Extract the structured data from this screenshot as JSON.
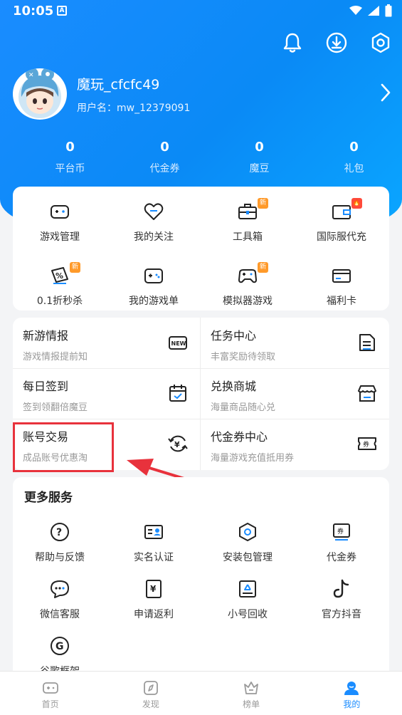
{
  "status_bar": {
    "time": "10:05",
    "badge": "A"
  },
  "header": {
    "icons": [
      "bell-icon",
      "download-icon",
      "settings-icon"
    ],
    "username": "魔玩_cfcfc49",
    "user_id": "用户名：mw_12379091"
  },
  "stats": [
    {
      "value": "0",
      "label": "平台币"
    },
    {
      "value": "0",
      "label": "代金券"
    },
    {
      "value": "0",
      "label": "魔豆"
    },
    {
      "value": "0",
      "label": "礼包"
    }
  ],
  "tools": [
    {
      "label": "游戏管理",
      "icon": "gamepad-icon",
      "tag": ""
    },
    {
      "label": "我的关注",
      "icon": "heart-icon",
      "tag": ""
    },
    {
      "label": "工具箱",
      "icon": "toolbox-icon",
      "tag": "新"
    },
    {
      "label": "国际服代充",
      "icon": "wallet-icon",
      "tag": "🔥"
    },
    {
      "label": "0.1折秒杀",
      "icon": "discount-icon",
      "tag": "新"
    },
    {
      "label": "我的游戏单",
      "icon": "controller-icon",
      "tag": ""
    },
    {
      "label": "模拟器游戏",
      "icon": "emulator-icon",
      "tag": "新"
    },
    {
      "label": "福利卡",
      "icon": "card-icon",
      "tag": ""
    }
  ],
  "services": [
    {
      "title": "新游情报",
      "subtitle": "游戏情报提前知",
      "icon": "new-icon"
    },
    {
      "title": "任务中心",
      "subtitle": "丰富奖励待领取",
      "icon": "task-icon"
    },
    {
      "title": "每日签到",
      "subtitle": "签到领翻倍魔豆",
      "icon": "calendar-icon"
    },
    {
      "title": "兑换商城",
      "subtitle": "海量商品随心兑",
      "icon": "shop-icon"
    },
    {
      "title": "账号交易",
      "subtitle": "成品账号优惠淘",
      "icon": "exchange-icon"
    },
    {
      "title": "代金券中心",
      "subtitle": "海量游戏充值抵用券",
      "icon": "coupon-icon"
    }
  ],
  "more": {
    "title": "更多服务",
    "items": [
      {
        "label": "帮助与反馈",
        "icon": "help-icon"
      },
      {
        "label": "实名认证",
        "icon": "id-card-icon"
      },
      {
        "label": "安装包管理",
        "icon": "package-icon"
      },
      {
        "label": "代金券",
        "icon": "voucher-icon"
      },
      {
        "label": "微信客服",
        "icon": "chat-icon"
      },
      {
        "label": "申请返利",
        "icon": "rebate-icon"
      },
      {
        "label": "小号回收",
        "icon": "recycle-icon"
      },
      {
        "label": "官方抖音",
        "icon": "tiktok-icon"
      },
      {
        "label": "谷歌框架",
        "icon": "google-icon"
      }
    ]
  },
  "tabbar": [
    {
      "label": "首页",
      "icon": "home-gamepad-icon",
      "active": false
    },
    {
      "label": "发现",
      "icon": "compass-icon",
      "active": false
    },
    {
      "label": "榜单",
      "icon": "trophy-icon",
      "active": false
    },
    {
      "label": "我的",
      "icon": "user-icon",
      "active": true
    }
  ],
  "colors": {
    "brand": "#1a8cff",
    "highlight": "#e8323c"
  }
}
